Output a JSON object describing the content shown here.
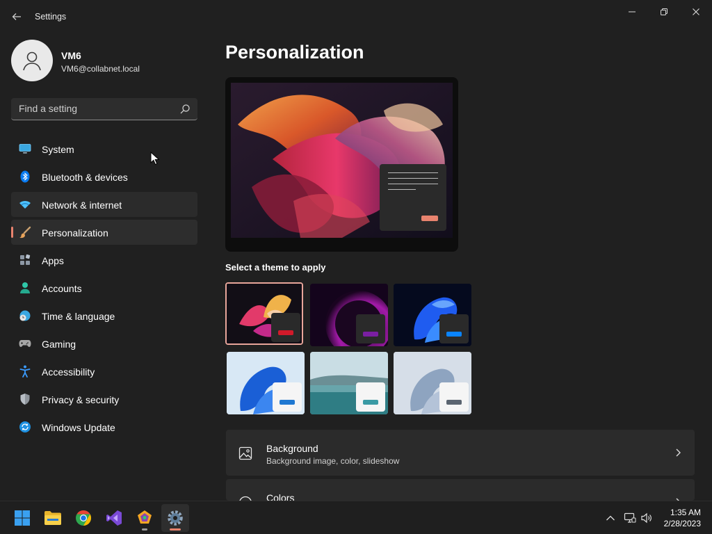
{
  "window": {
    "title": "Settings",
    "controls": [
      "minimize",
      "maximize",
      "close"
    ]
  },
  "user": {
    "name": "VM6",
    "email": "VM6@collabnet.local"
  },
  "search": {
    "placeholder": "Find a setting",
    "value": ""
  },
  "nav": {
    "items": [
      {
        "label": "System",
        "icon": "monitor-icon",
        "color": "#4cc2ff"
      },
      {
        "label": "Bluetooth & devices",
        "icon": "bluetooth-icon",
        "color": "#0a84ff"
      },
      {
        "label": "Network & internet",
        "icon": "wifi-icon",
        "color": "#4cc2ff"
      },
      {
        "label": "Personalization",
        "icon": "brush-icon",
        "color": "#e8a35a"
      },
      {
        "label": "Apps",
        "icon": "apps-icon",
        "color": "#9aa5b1"
      },
      {
        "label": "Accounts",
        "icon": "person-icon",
        "color": "#2fc7a8"
      },
      {
        "label": "Time & language",
        "icon": "globe-clock-icon",
        "color": "#4cc2ff"
      },
      {
        "label": "Gaming",
        "icon": "gamepad-icon",
        "color": "#a7a7a7"
      },
      {
        "label": "Accessibility",
        "icon": "accessibility-icon",
        "color": "#3a9bff"
      },
      {
        "label": "Privacy & security",
        "icon": "shield-icon",
        "color": "#9aa0a6"
      },
      {
        "label": "Windows Update",
        "icon": "update-icon",
        "color": "#2ea8ff"
      }
    ],
    "selected": "Personalization",
    "hovered": "Network & internet"
  },
  "main": {
    "title": "Personalization",
    "theme_section_label": "Select a theme to apply",
    "themes": [
      {
        "name": "theme-glow-dark",
        "selected": true,
        "accent": "#d21a2a"
      },
      {
        "name": "theme-purple-dark",
        "selected": false,
        "accent": "#7a1fa2"
      },
      {
        "name": "theme-bloom-dark",
        "selected": false,
        "accent": "#0a84ff"
      },
      {
        "name": "theme-bloom-light",
        "selected": false,
        "accent": "#1f78d1"
      },
      {
        "name": "theme-lake-light",
        "selected": false,
        "accent": "#3a9aa4"
      },
      {
        "name": "theme-flow-light",
        "selected": false,
        "accent": "#5a6470"
      }
    ],
    "cards": [
      {
        "title": "Background",
        "subtitle": "Background image, color, slideshow",
        "icon": "image-icon"
      },
      {
        "title": "Colors",
        "subtitle": "",
        "icon": "palette-icon"
      }
    ]
  },
  "taskbar": {
    "apps": [
      {
        "name": "start",
        "icon": "windows-logo-icon"
      },
      {
        "name": "file-explorer",
        "icon": "folder-icon"
      },
      {
        "name": "chrome",
        "icon": "chrome-icon"
      },
      {
        "name": "visual-studio",
        "icon": "visual-studio-icon"
      },
      {
        "name": "paint-app",
        "icon": "palette-app-icon"
      },
      {
        "name": "settings",
        "icon": "gear-icon"
      }
    ],
    "tray": [
      "chevron-up-icon",
      "network-icon",
      "volume-icon"
    ],
    "time": "1:35 AM",
    "date": "2/28/2023"
  },
  "colors": {
    "accent": "#e8836e",
    "background": "#202020",
    "card": "#2b2b2b"
  }
}
